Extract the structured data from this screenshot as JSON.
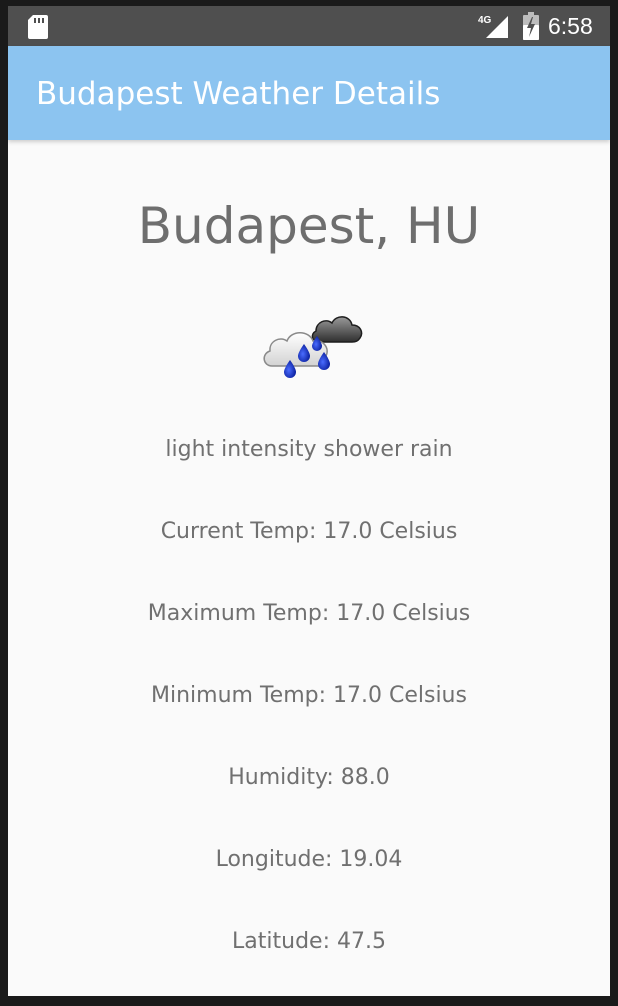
{
  "status_bar": {
    "network_label": "4G",
    "time": "6:58",
    "icons": [
      "sd-card-icon",
      "signal-icon",
      "battery-charging-icon"
    ]
  },
  "app_bar": {
    "title": "Budapest Weather Details",
    "color": "#8cc4f0"
  },
  "weather": {
    "city": "Budapest, HU",
    "icon": "rain-cloud-icon",
    "description": "light intensity shower rain",
    "current_temp": "Current Temp: 17.0 Celsius",
    "max_temp": "Maximum Temp: 17.0 Celsius",
    "min_temp": "Minimum Temp: 17.0 Celsius",
    "humidity": "Humidity: 88.0",
    "longitude": "Longitude: 19.04",
    "latitude": "Latitude: 47.5"
  }
}
